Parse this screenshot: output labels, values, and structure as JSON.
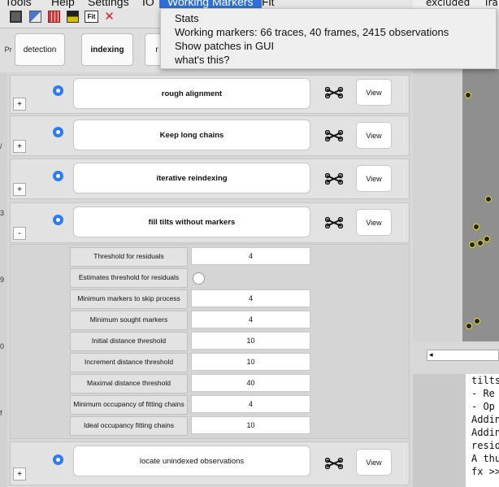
{
  "menubar": {
    "items": [
      "Tools",
      "Help",
      "Settings",
      "IO",
      "Working Markers",
      "Fit"
    ]
  },
  "toolbar": {
    "icons": [
      "red-grid-icon",
      "adjust-icon",
      "grid-icon",
      "dashed-grid-icon",
      "fit-icon",
      "cross-icon"
    ],
    "fit_label": "Fit"
  },
  "tabs": [
    "detection",
    "indexing",
    "r",
    "",
    ""
  ],
  "left_edge": [
    "Pr",
    "/",
    "3",
    "9",
    "0",
    "f"
  ],
  "steps": [
    {
      "name": "rough alignment",
      "toggle": "+",
      "view": "View",
      "bold": true
    },
    {
      "name": "Keep long chains",
      "toggle": "+",
      "view": "View",
      "bold": true
    },
    {
      "name": "iterative reindexing",
      "toggle": "+",
      "view": "View",
      "bold": true
    },
    {
      "name": "fill tilts without markers",
      "toggle": "-",
      "view": "View",
      "bold": true
    },
    {
      "name": "locate unindexed observations",
      "toggle": "+",
      "view": "View",
      "bold": false
    }
  ],
  "params": [
    {
      "label": "Threshold for residuals",
      "value": "4"
    },
    {
      "label": "Estimates threshold for residuals",
      "value": null,
      "checkbox": false
    },
    {
      "label": "Minimum markers to skip process",
      "value": "4"
    },
    {
      "label": "Minimum sought markers",
      "value": "4"
    },
    {
      "label": "Initial distance threshold",
      "value": "10"
    },
    {
      "label": "Increment distance threshold",
      "value": "10"
    },
    {
      "label": "Maximal distance threshold",
      "value": "40"
    },
    {
      "label": "Minimum occupancy of fitting chains",
      "value": "4"
    },
    {
      "label": "Ideal occupancy fitting chains",
      "value": "10"
    }
  ],
  "dropdown": {
    "items": [
      "Stats",
      "Working markers:  66 traces, 40 frames, 2415 observations",
      "Show patches in GUI",
      "what's this?"
    ]
  },
  "right_header": {
    "excluded": "excluded",
    "tra": "Tra"
  },
  "console": {
    "lines": [
      "tilts",
      " - Re",
      " - Op",
      "Addin",
      "Addin",
      "resid",
      "A thu",
      "fx >>"
    ]
  },
  "colors": {
    "menu_highlight": "#2f6fd8",
    "radio": "#2b7bf6",
    "marker_ring": "#e8e000"
  }
}
